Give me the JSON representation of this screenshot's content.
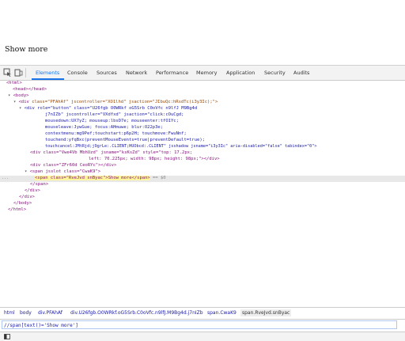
{
  "page": {
    "show_more": "Show more"
  },
  "devtools": {
    "tabs": [
      "Elements",
      "Console",
      "Sources",
      "Network",
      "Performance",
      "Memory",
      "Application",
      "Security",
      "Audits"
    ],
    "active_tab": "Elements",
    "dom": {
      "l1": "<html>",
      "l2": "<head></head>",
      "l3": "<body>",
      "l4_tag": "<div ",
      "l4_attrs": "class=\"PFAhAf\" jscontroller=\"XO1lhd\" jsaction=\"JIbuQc:hRsdTc(i3y3Ic);\">",
      "l5": "<div role=\"button\" class=\"U26fgb O0WRkf oG5Srb C0oVfc n9lfJ M9Bg4d",
      "l6": "j7nIZb\" jscontroller=\"VXdfxd\" jsaction=\"click:cOuCgd;",
      "l7": "mousedown:UX7yZ; mouseup:lbsD7e; mouseenter:tfO1Yc;",
      "l8": "mouseleave:JywGue; focus:AHmuwe; blur:O22p3e;",
      "l9": "contextmenu:mg9Pef;touchstart:p6p2H; touchmove:FwuNnf;",
      "l10": "touchend:yfqBxc(preventMouseEvents=true|preventDefault=true);",
      "l11": "touchcancel:JMtRjd;j9grLe:.CLIENT;HUObcd:.CLIENT\" jsshadow jsname=\"i3y3Ic\" aria-disabled=\"false\" tabindex=\"0\">",
      "l12": "<div class=\"Vwe4Vb MbhUzd\" jsname=\"ksKsZd\" style=\"top: 17.2px;",
      "l13": "left: 70.225px; width: 98px; height: 98px;\"></div>",
      "l14": "<div class=\"ZFr60d CeoRYc\"></div>",
      "l15": "<span jsslot class=\"CwaK9\">",
      "l16_span": "<span class=\"RveJvd snByac\">Show more</span>",
      "l16_tail": " == $0",
      "l17": "</span>",
      "l18": "</div>",
      "l19": "</div>",
      "l20": "</body>",
      "l21": "</html>",
      "ellipsis": "..."
    },
    "breadcrumbs": [
      "html",
      "body",
      "div.PFAhAf",
      "div.U26fgb.O0WRkf.oG5Srb.C0oVfc.n9lfJ.M9Bg4d.j7nIZb",
      "span.CwaK9",
      "span.RveJvd.snByac"
    ],
    "search_value": "//span[text()='Show more']"
  },
  "icons": {
    "inspect": "inspect-element-icon",
    "device": "device-toggle-icon",
    "drawer": "drawer-toggle-icon"
  },
  "colors": {
    "accent": "#1a73e8",
    "tag": "#881280",
    "attr_name": "#994500",
    "attr_value": "#1a1aa6",
    "highlight": "#fff59d"
  }
}
